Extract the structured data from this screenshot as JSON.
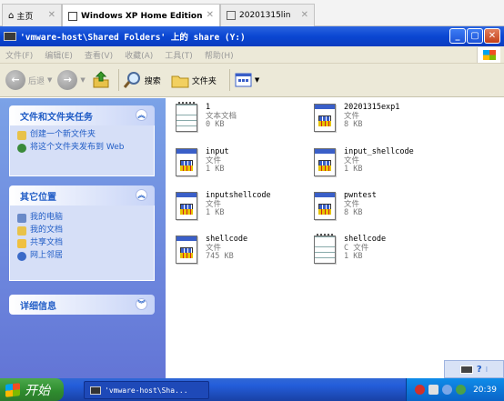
{
  "vm_tabs": [
    {
      "label": "主页",
      "active": false
    },
    {
      "label": "Windows XP Home Edition",
      "active": true
    },
    {
      "label": "20201315lin",
      "active": false
    }
  ],
  "window": {
    "title": "'vmware-host\\Shared Folders' 上的 share (Y:)"
  },
  "menu": [
    "文件(F)",
    "编辑(E)",
    "查看(V)",
    "收藏(A)",
    "工具(T)",
    "帮助(H)"
  ],
  "toolbar": {
    "back": "后退",
    "search": "搜索",
    "folders": "文件夹"
  },
  "left": {
    "tasks": {
      "title": "文件和文件夹任务",
      "items": [
        "创建一个新文件夹",
        "将这个文件夹发布到 Web"
      ]
    },
    "places": {
      "title": "其它位置",
      "items": [
        "我的电脑",
        "我的文档",
        "共享文档",
        "网上邻居"
      ]
    },
    "details": {
      "title": "详细信息"
    }
  },
  "files": [
    {
      "name": "1",
      "type": "文本文档",
      "size": "0 KB",
      "icon": "text-document-icon"
    },
    {
      "name": "20201315exp1",
      "type": "文件",
      "size": "8 KB",
      "icon": "generic-file-icon"
    },
    {
      "name": "input",
      "type": "文件",
      "size": "1 KB",
      "icon": "generic-file-icon"
    },
    {
      "name": "input_shellcode",
      "type": "文件",
      "size": "1 KB",
      "icon": "generic-file-icon"
    },
    {
      "name": "inputshellcode",
      "type": "文件",
      "size": "1 KB",
      "icon": "generic-file-icon"
    },
    {
      "name": "pwntest",
      "type": "文件",
      "size": "8 KB",
      "icon": "generic-file-icon"
    },
    {
      "name": "shellcode",
      "type": "文件",
      "size": "745 KB",
      "icon": "generic-file-icon"
    },
    {
      "name": "shellcode",
      "type": "C 文件",
      "size": "1 KB",
      "icon": "text-document-icon"
    }
  ],
  "taskbar": {
    "start": "开始",
    "task": "'vmware-host\\Sha...",
    "clock": "20:39"
  }
}
